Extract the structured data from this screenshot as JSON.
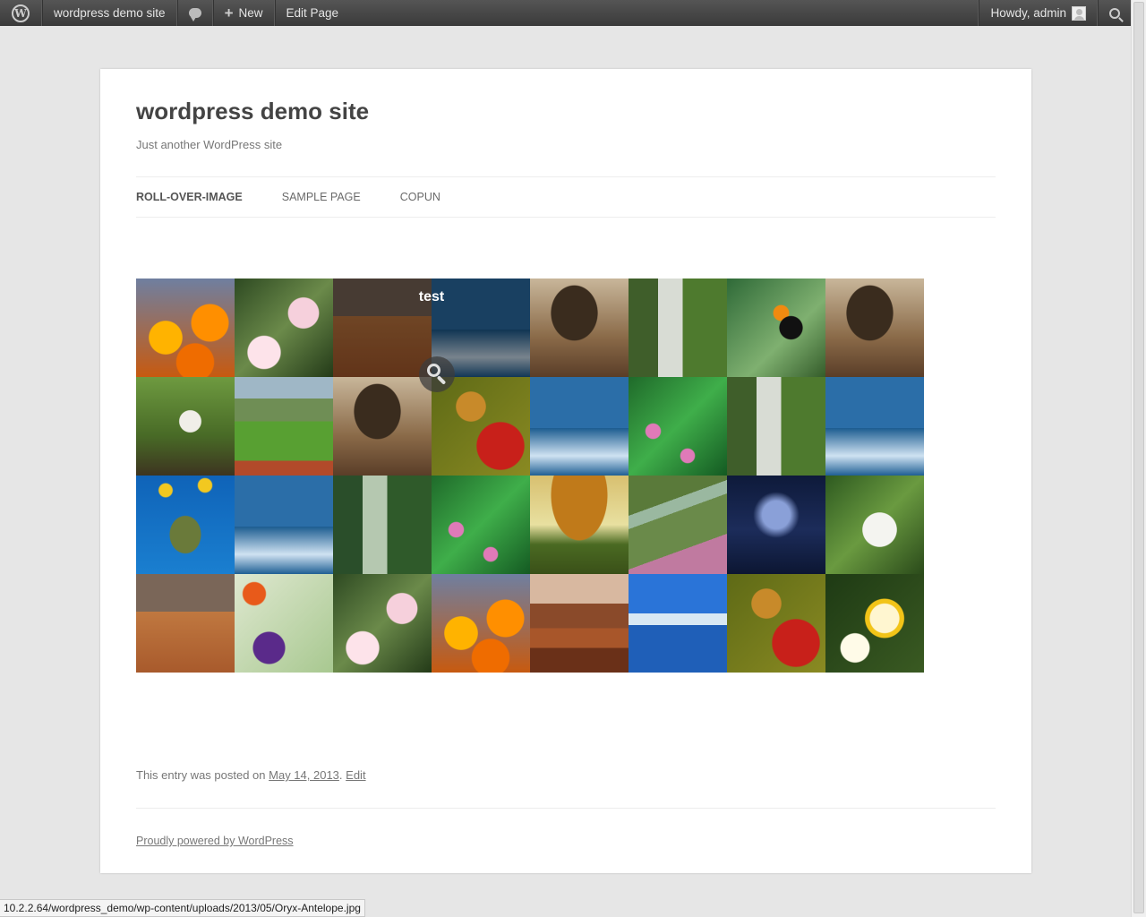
{
  "admin_bar": {
    "site_name": "wordpress demo site",
    "new_label": "New",
    "edit_label": "Edit Page",
    "howdy": "Howdy, admin"
  },
  "site": {
    "title": "wordpress demo site",
    "description": "Just another WordPress site"
  },
  "nav": {
    "items": [
      "ROLL-OVER-IMAGE",
      "SAMPLE PAGE",
      "COPUN"
    ]
  },
  "gallery": {
    "hover_title": "test",
    "tiles": [
      "orange flowers",
      "pink plumeria",
      "desert oryx",
      "whale tail",
      "trees at dusk",
      "waterfall stream",
      "toucan",
      "trees at dusk",
      "woman by pond",
      "green valley",
      "trees at dusk",
      "butterfly on red flower",
      "whale tail",
      "pink wildflowers",
      "waterfall stream",
      "whale tail",
      "sea turtle",
      "whale tail",
      "forest path",
      "pink wildflowers",
      "autumn tree",
      "meadow creek",
      "moonlit tree",
      "white egret",
      "desert oryx",
      "purple flowers",
      "pink plumeria",
      "orange flowers",
      "monument valley",
      "blue pier",
      "butterfly on red flower",
      "white frangipani"
    ]
  },
  "entry": {
    "prefix": "This entry was posted on ",
    "date": "May 14, 2013",
    "sep": ". ",
    "edit": "Edit"
  },
  "footer": {
    "text": "Proudly powered by WordPress"
  },
  "status_url": "10.2.2.64/wordpress_demo/wp-content/uploads/2013/05/Oryx-Antelope.jpg"
}
